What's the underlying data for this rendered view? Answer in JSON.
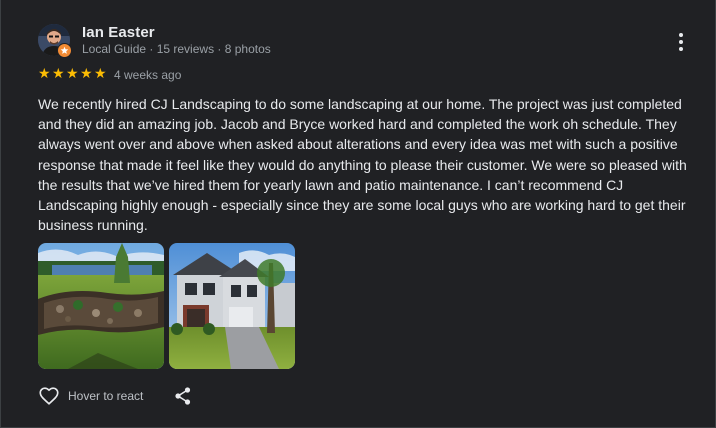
{
  "reviewer": {
    "name": "Ian Easter",
    "meta": "Local Guide · 15 reviews · 8 photos",
    "avatar_icon": "user-avatar",
    "badge_icon": "local-guide-star-icon"
  },
  "rating": {
    "stars": 5,
    "max": 5,
    "glyph": "★",
    "color": "#fbbc04",
    "date": "4 weeks ago"
  },
  "review": {
    "text": "We recently hired CJ Landscaping to do some landscaping at our home. The project was just completed and they did an amazing job. Jacob and Bryce worked hard and completed the work oh schedule. They always went over and above when asked about alterations and every idea was met with such a positive response that made it feel like they would do anything to please their customer. We were so pleased with the results that we’ve hired them for yearly lawn and patio maintenance. I can’t recommend CJ Landscaping highly enough - especially since they are some local guys who are working hard to get their business running."
  },
  "photos": [
    {
      "subject": "landscaped-garden-bed-by-pond"
    },
    {
      "subject": "house-with-new-lawn"
    }
  ],
  "actions": {
    "react_label": "Hover to react",
    "react_icon": "heart-outline-icon",
    "share_icon": "share-icon",
    "more_icon": "more-vert-icon"
  },
  "colors": {
    "background": "#202124",
    "text": "#e8eaed",
    "secondary_text": "#9aa0a6",
    "star": "#fbbc04"
  }
}
